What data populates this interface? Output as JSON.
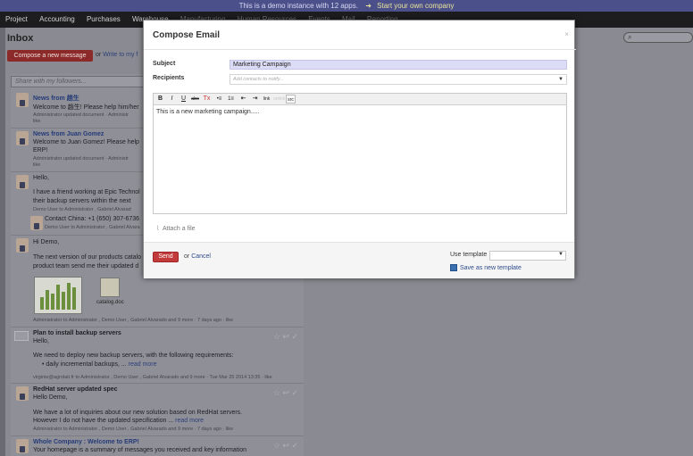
{
  "banner": {
    "text": "This is a demo instance with 12 apps.",
    "link": "Start your own company"
  },
  "menu": {
    "items": [
      "Project",
      "Accounting",
      "Purchases",
      "Warehouse",
      "Manufacturing",
      "Human Resources",
      "Events",
      "Mail",
      "Reporting"
    ]
  },
  "inbox": {
    "title": "Inbox",
    "compose_label": "Compose a new message",
    "or_text": "or",
    "write_link": "Write to my f",
    "share_placeholder": "Share with my followers..."
  },
  "feed": [
    {
      "title": "News from 趙生",
      "body": "Welcome to 趙生! Please help him/her",
      "meta": "Administrator updated document · Administr",
      "meta2": "like"
    },
    {
      "title": "News from Juan Gomez",
      "body": "Welcome to Juan Gomez! Please help",
      "body2": "ERP!",
      "meta": "Administrator updated document · Administr",
      "meta2": "like"
    },
    {
      "title": "Hello,",
      "body": "I have a friend working at Epic Technol",
      "body2": "their backup servers within the next",
      "meta": "Demo User to Administrator , Gabriel Alvarad"
    },
    {
      "title": "Contact China: +1 (650) 307-6736",
      "meta": "Demo User to Administrator , Gabriel Alvara"
    },
    {
      "title": "Hi Demo,",
      "body": "The next version of our products catalo",
      "body2": "product team send me their updated d",
      "attachment": "catalog.doc",
      "meta": "Administrator to Administrator , Demo User , Gabriel Alvarado and 9 more · 7 days ago · like"
    },
    {
      "title": "Plan to install backup servers",
      "body": "Hello,",
      "body2": "We need to deploy new backup servers, with the following requirements:",
      "bullet": "daily incremental backups, ...",
      "more": "read more",
      "meta": "virginie@agrolait.fr to Administrator , Demo User , Gabriel Alvarado and 9 more · Tue Mar 25 2014 13:35 · like"
    },
    {
      "title": "RedHat server updated spec",
      "body": "Hello Demo,",
      "body2": "We have a lot of inquiries about our new solution based on RedHat servers.",
      "body3": "However I do not have the updated specification ...",
      "more": "read more",
      "meta": "Administrator to Administrator , Demo User , Gabriel Alvarado and 9 more · 7 days ago · like"
    },
    {
      "title": "Whole Company : Welcome to ERP!",
      "body": "Your homepage is a summary of messages you received and key information"
    }
  ],
  "modal": {
    "title": "Compose Email",
    "close": "×",
    "subject_label": "Subject",
    "subject_value": "Marketing Campaign",
    "recipients_label": "Recipients",
    "recipients_placeholder": "Add contacts to notify...",
    "toolbar": [
      "B",
      "I",
      "U",
      "abc",
      "Tx",
      "•≡",
      "1≡",
      "⇤",
      "⇥",
      "link",
      "unlink",
      "src"
    ],
    "body_text": "This is a new marketing campaign.....",
    "attach_label": "Attach a file",
    "send_label": "Send",
    "or_text": "or",
    "cancel_label": "Cancel",
    "use_template_label": "Use template",
    "template_value": "",
    "save_template_label": "Save as new template"
  },
  "colors": {
    "send": "#c23a3a",
    "banner": "#4b4f8a",
    "subject_bg": "#dcdcf6"
  }
}
